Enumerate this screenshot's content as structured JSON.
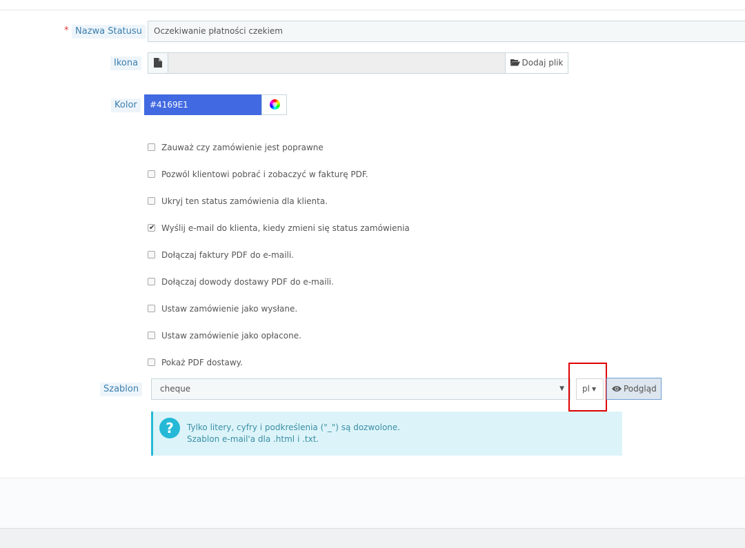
{
  "form": {
    "name_label": "Nazwa Statusu",
    "required_marker": "*",
    "name_value": "Oczekiwanie płatności czekiem",
    "icon_label": "Ikona",
    "add_file_label": "Dodaj plik",
    "color_label": "Kolor",
    "color_value": "#4169E1",
    "options": [
      {
        "label": "Zauważ czy zamówienie jest poprawne",
        "checked": false
      },
      {
        "label": "Pozwól klientowi pobrać i zobaczyć w fakturę PDF.",
        "checked": false
      },
      {
        "label": "Ukryj ten status zamówienia dla klienta.",
        "checked": false
      },
      {
        "label": "Wyślij e-mail do klienta, kiedy zmieni się status zamówienia",
        "checked": true
      },
      {
        "label": "Dołączaj faktury PDF do e-maili.",
        "checked": false
      },
      {
        "label": "Dołączaj dowody dostawy PDF do e-maili.",
        "checked": false
      },
      {
        "label": "Ustaw zamówienie jako wysłane.",
        "checked": false
      },
      {
        "label": "Ustaw zamówienie jako opłacone.",
        "checked": false
      },
      {
        "label": "Pokaż PDF dostawy.",
        "checked": false
      }
    ],
    "template_label": "Szablon",
    "template_value": "cheque",
    "lang_value": "pl",
    "preview_label": "Podgląd",
    "info_lines": [
      "Tylko litery, cyfry i podkreślenia (\"_\") są dozwolone.",
      "Szablon e-mail'a dla .html i .txt."
    ]
  },
  "icons": {
    "file": "file-icon",
    "folder": "folder-open-icon",
    "color_picker": "color-wheel-icon",
    "caret": "caret-down-icon",
    "eye": "eye-icon",
    "question": "question-circle-icon"
  },
  "colors": {
    "accent_color_value": "#4169E1",
    "label_text": "#3b7eaf",
    "info_bg": "#dcf4f9",
    "info_accent": "#25b9d7",
    "highlight": "#e00000"
  }
}
